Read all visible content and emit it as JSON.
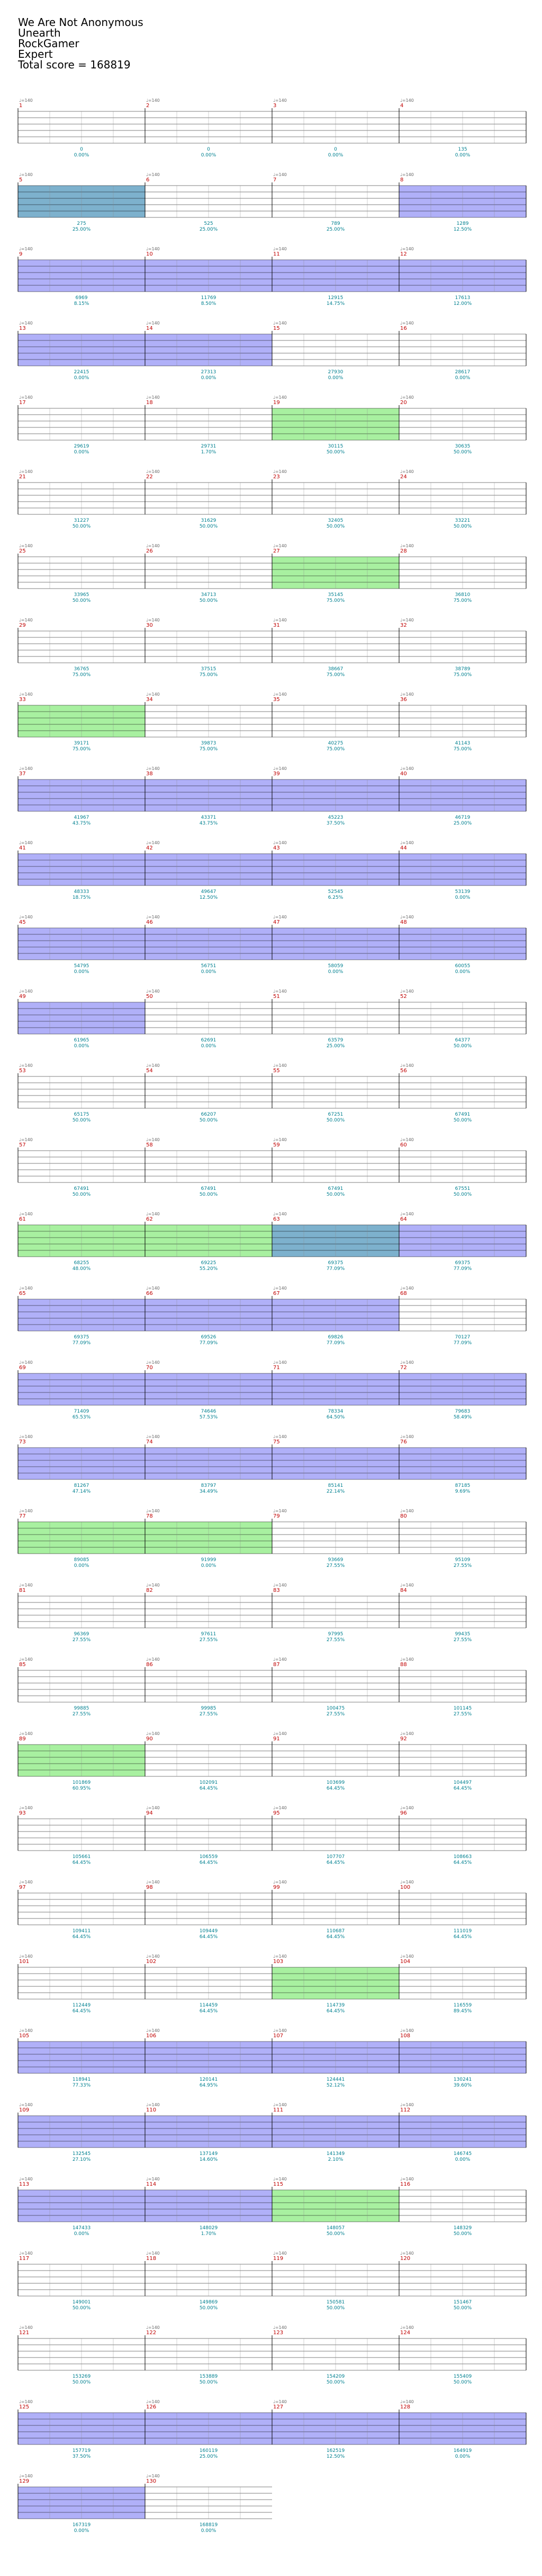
{
  "header": {
    "song": "We Are Not Anonymous",
    "artist": "Unearth",
    "charter": "RockGamer",
    "difficulty": "Expert",
    "total_score_label": "Total score = 168819"
  },
  "tempo_label": "♩=140",
  "colors": {
    "green": "#22cc22",
    "red": "#e01818",
    "yellow": "#f0e020",
    "blue": "#1a2fd0",
    "orange": "#f08800",
    "starpower": "#b0b0f8",
    "solo": "#a8f0a0",
    "overlap": "#6fa8c8",
    "grid": "#000000",
    "score_text": "#008090"
  },
  "measures": [
    {
      "n": 1,
      "score": "0",
      "pct": "0.00%"
    },
    {
      "n": 2,
      "score": "0",
      "pct": "0.00%"
    },
    {
      "n": 3,
      "score": "0",
      "pct": "0.00%"
    },
    {
      "n": 4,
      "score": "135",
      "pct": "0.00%"
    },
    {
      "n": 5,
      "score": "275",
      "pct": "25.00%"
    },
    {
      "n": 6,
      "score": "525",
      "pct": "25.00%"
    },
    {
      "n": 7,
      "score": "789",
      "pct": "25.00%"
    },
    {
      "n": 8,
      "score": "1289",
      "pct": "12.50%"
    },
    {
      "n": 9,
      "score": "6969",
      "pct": "8.15%"
    },
    {
      "n": 10,
      "score": "11769",
      "pct": "8.50%"
    },
    {
      "n": 11,
      "score": "12915",
      "pct": "14.75%"
    },
    {
      "n": 12,
      "score": "17613",
      "pct": "12.00%"
    },
    {
      "n": 13,
      "score": "22415",
      "pct": "0.00%"
    },
    {
      "n": 14,
      "score": "27313",
      "pct": "0.00%"
    },
    {
      "n": 15,
      "score": "27930",
      "pct": "0.00%"
    },
    {
      "n": 16,
      "score": "28617",
      "pct": "0.00%"
    },
    {
      "n": 17,
      "score": "29619",
      "pct": "0.00%"
    },
    {
      "n": 18,
      "score": "29731",
      "pct": "1.70%"
    },
    {
      "n": 19,
      "score": "30115",
      "pct": "50.00%"
    },
    {
      "n": 20,
      "score": "30635",
      "pct": "50.00%"
    },
    {
      "n": 21,
      "score": "31227",
      "pct": "50.00%"
    },
    {
      "n": 22,
      "score": "31629",
      "pct": "50.00%"
    },
    {
      "n": 23,
      "score": "32405",
      "pct": "50.00%"
    },
    {
      "n": 24,
      "score": "33221",
      "pct": "50.00%"
    },
    {
      "n": 25,
      "score": "33965",
      "pct": "50.00%"
    },
    {
      "n": 26,
      "score": "34713",
      "pct": "50.00%"
    },
    {
      "n": 27,
      "score": "35145",
      "pct": "75.00%"
    },
    {
      "n": 28,
      "score": "36810",
      "pct": "75.00%"
    },
    {
      "n": 29,
      "score": "36765",
      "pct": "75.00%"
    },
    {
      "n": 30,
      "score": "37515",
      "pct": "75.00%"
    },
    {
      "n": 31,
      "score": "38667",
      "pct": "75.00%"
    },
    {
      "n": 32,
      "score": "38789",
      "pct": "75.00%"
    },
    {
      "n": 33,
      "score": "39171",
      "pct": "75.00%"
    },
    {
      "n": 34,
      "score": "39873",
      "pct": "75.00%"
    },
    {
      "n": 35,
      "score": "40275",
      "pct": "75.00%"
    },
    {
      "n": 36,
      "score": "41143",
      "pct": "75.00%"
    },
    {
      "n": 37,
      "score": "41967",
      "pct": "43.75%"
    },
    {
      "n": 38,
      "score": "43371",
      "pct": "43.75%"
    },
    {
      "n": 39,
      "score": "45223",
      "pct": "37.50%"
    },
    {
      "n": 40,
      "score": "46719",
      "pct": "25.00%"
    },
    {
      "n": 41,
      "score": "48333",
      "pct": "18.75%"
    },
    {
      "n": 42,
      "score": "49647",
      "pct": "12.50%"
    },
    {
      "n": 43,
      "score": "52545",
      "pct": "6.25%"
    },
    {
      "n": 44,
      "score": "53139",
      "pct": "0.00%"
    },
    {
      "n": 45,
      "score": "54795",
      "pct": "0.00%"
    },
    {
      "n": 46,
      "score": "56751",
      "pct": "0.00%"
    },
    {
      "n": 47,
      "score": "58059",
      "pct": "0.00%"
    },
    {
      "n": 48,
      "score": "60055",
      "pct": "0.00%"
    },
    {
      "n": 49,
      "score": "61965",
      "pct": "0.00%"
    },
    {
      "n": 50,
      "score": "62691",
      "pct": "0.00%"
    },
    {
      "n": 51,
      "score": "63579",
      "pct": "25.00%"
    },
    {
      "n": 52,
      "score": "64377",
      "pct": "50.00%"
    },
    {
      "n": 53,
      "score": "65175",
      "pct": "50.00%"
    },
    {
      "n": 54,
      "score": "66207",
      "pct": "50.00%"
    },
    {
      "n": 55,
      "score": "67251",
      "pct": "50.00%"
    },
    {
      "n": 56,
      "score": "67491",
      "pct": "50.00%"
    },
    {
      "n": 57,
      "score": "67491",
      "pct": "50.00%"
    },
    {
      "n": 58,
      "score": "67491",
      "pct": "50.00%"
    },
    {
      "n": 59,
      "score": "67491",
      "pct": "50.00%"
    },
    {
      "n": 60,
      "score": "67551",
      "pct": "50.00%"
    },
    {
      "n": 61,
      "score": "68255",
      "pct": "48.00%"
    },
    {
      "n": 62,
      "score": "69225",
      "pct": "55.20%"
    },
    {
      "n": 63,
      "score": "69375",
      "pct": "77.09%"
    },
    {
      "n": 64,
      "score": "69375",
      "pct": "77.09%"
    },
    {
      "n": 65,
      "score": "69375",
      "pct": "77.09%"
    },
    {
      "n": 66,
      "score": "69526",
      "pct": "77.09%"
    },
    {
      "n": 67,
      "score": "69826",
      "pct": "77.09%"
    },
    {
      "n": 68,
      "score": "70127",
      "pct": "77.09%"
    },
    {
      "n": 69,
      "score": "71409",
      "pct": "65.53%"
    },
    {
      "n": 70,
      "score": "74646",
      "pct": "57.53%"
    },
    {
      "n": 71,
      "score": "78334",
      "pct": "64.50%"
    },
    {
      "n": 72,
      "score": "79683",
      "pct": "58.49%"
    },
    {
      "n": 73,
      "score": "81267",
      "pct": "47.14%"
    },
    {
      "n": 74,
      "score": "83797",
      "pct": "34.49%"
    },
    {
      "n": 75,
      "score": "85141",
      "pct": "22.14%"
    },
    {
      "n": 76,
      "score": "87185",
      "pct": "9.69%"
    },
    {
      "n": 77,
      "score": "89085",
      "pct": "0.00%"
    },
    {
      "n": 78,
      "score": "91999",
      "pct": "0.00%"
    },
    {
      "n": 79,
      "score": "93669",
      "pct": "27.55%"
    },
    {
      "n": 80,
      "score": "95109",
      "pct": "27.55%"
    },
    {
      "n": 81,
      "score": "96369",
      "pct": "27.55%"
    },
    {
      "n": 82,
      "score": "97611",
      "pct": "27.55%"
    },
    {
      "n": 83,
      "score": "97995",
      "pct": "27.55%"
    },
    {
      "n": 84,
      "score": "99435",
      "pct": "27.55%"
    },
    {
      "n": 85,
      "score": "99885",
      "pct": "27.55%"
    },
    {
      "n": 86,
      "score": "99985",
      "pct": "27.55%"
    },
    {
      "n": 87,
      "score": "100475",
      "pct": "27.55%"
    },
    {
      "n": 88,
      "score": "101145",
      "pct": "27.55%"
    },
    {
      "n": 89,
      "score": "101869",
      "pct": "60.95%"
    },
    {
      "n": 90,
      "score": "102091",
      "pct": "64.45%"
    },
    {
      "n": 91,
      "score": "103699",
      "pct": "64.45%"
    },
    {
      "n": 92,
      "score": "104497",
      "pct": "64.45%"
    },
    {
      "n": 93,
      "score": "105661",
      "pct": "64.45%"
    },
    {
      "n": 94,
      "score": "106559",
      "pct": "64.45%"
    },
    {
      "n": 95,
      "score": "107707",
      "pct": "64.45%"
    },
    {
      "n": 96,
      "score": "108663",
      "pct": "64.45%"
    },
    {
      "n": 97,
      "score": "109411",
      "pct": "64.45%"
    },
    {
      "n": 98,
      "score": "109449",
      "pct": "64.45%"
    },
    {
      "n": 99,
      "score": "110687",
      "pct": "64.45%"
    },
    {
      "n": 100,
      "score": "111019",
      "pct": "64.45%"
    },
    {
      "n": 101,
      "score": "112449",
      "pct": "64.45%"
    },
    {
      "n": 102,
      "score": "114459",
      "pct": "64.45%"
    },
    {
      "n": 103,
      "score": "114739",
      "pct": "64.45%"
    },
    {
      "n": 104,
      "score": "116559",
      "pct": "89.45%"
    },
    {
      "n": 105,
      "score": "118941",
      "pct": "77.33%"
    },
    {
      "n": 106,
      "score": "120141",
      "pct": "64.95%"
    },
    {
      "n": 107,
      "score": "124441",
      "pct": "52.12%"
    },
    {
      "n": 108,
      "score": "130241",
      "pct": "39.60%"
    },
    {
      "n": 109,
      "score": "132545",
      "pct": "27.10%"
    },
    {
      "n": 110,
      "score": "137149",
      "pct": "14.60%"
    },
    {
      "n": 111,
      "score": "141349",
      "pct": "2.10%"
    },
    {
      "n": 112,
      "score": "146745",
      "pct": "0.00%"
    },
    {
      "n": 113,
      "score": "147433",
      "pct": "0.00%"
    },
    {
      "n": 114,
      "score": "148029",
      "pct": "1.70%"
    },
    {
      "n": 115,
      "score": "148057",
      "pct": "50.00%"
    },
    {
      "n": 116,
      "score": "148329",
      "pct": "50.00%"
    },
    {
      "n": 117,
      "score": "149001",
      "pct": "50.00%"
    },
    {
      "n": 118,
      "score": "149869",
      "pct": "50.00%"
    },
    {
      "n": 119,
      "score": "150581",
      "pct": "50.00%"
    },
    {
      "n": 120,
      "score": "151467",
      "pct": "50.00%"
    },
    {
      "n": 121,
      "score": "153269",
      "pct": "50.00%"
    },
    {
      "n": 122,
      "score": "153889",
      "pct": "50.00%"
    },
    {
      "n": 123,
      "score": "154209",
      "pct": "50.00%"
    },
    {
      "n": 124,
      "score": "155409",
      "pct": "50.00%"
    },
    {
      "n": 125,
      "score": "157719",
      "pct": "37.50%"
    },
    {
      "n": 126,
      "score": "160119",
      "pct": "25.00%"
    },
    {
      "n": 127,
      "score": "162519",
      "pct": "12.50%"
    },
    {
      "n": 128,
      "score": "164919",
      "pct": "0.00%"
    },
    {
      "n": 129,
      "score": "167319",
      "pct": "0.00%"
    },
    {
      "n": 130,
      "score": "168819",
      "pct": "0.00%"
    }
  ],
  "starpower_measures": [
    5,
    8,
    9,
    10,
    11,
    12,
    13,
    14,
    37,
    38,
    39,
    40,
    41,
    42,
    43,
    44,
    45,
    46,
    47,
    48,
    49,
    63,
    64,
    65,
    66,
    67,
    69,
    70,
    71,
    72,
    73,
    74,
    75,
    76,
    105,
    106,
    107,
    108,
    109,
    110,
    111,
    112,
    113,
    114,
    125,
    126,
    127,
    128,
    129
  ],
  "solo_measures": [
    5,
    19,
    27,
    33,
    61,
    62,
    63,
    77,
    78,
    89,
    103,
    115
  ]
}
